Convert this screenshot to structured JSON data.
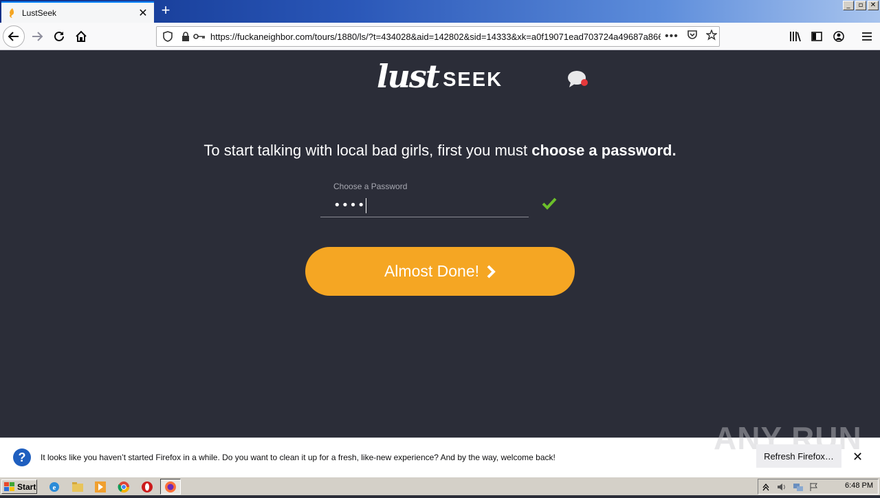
{
  "browser": {
    "tab_title": "LustSeek",
    "url": "https://fuckaneighbor.com/tours/1880/ls/?t=434028&aid=142802&sid=14333&xk=a0f19071ead703724a49687a866",
    "url_more": "•••",
    "window_controls": [
      "_",
      "▫",
      "✕"
    ]
  },
  "page": {
    "logo_lust": "lust",
    "logo_seek": "SEEK",
    "headline_plain": "To start talking with local bad girls, first you must ",
    "headline_bold": "choose a password.",
    "password_label": "Choose a Password",
    "password_value": "••••",
    "submit_label": "Almost Done!",
    "colors": {
      "background": "#2b2d38",
      "button": "#f5a623",
      "check": "#6cbf2a",
      "notif_dot": "#e5383b"
    }
  },
  "notification": {
    "text": "It looks like you haven’t started Firefox in a while. Do you want to clean it up for a fresh, like-new experience? And by the way, welcome back!",
    "refresh_label": "Refresh Firefox…",
    "close": "✕"
  },
  "watermark": "ANY RUN",
  "taskbar": {
    "start_label": "Start",
    "clock": "6:48 PM"
  }
}
